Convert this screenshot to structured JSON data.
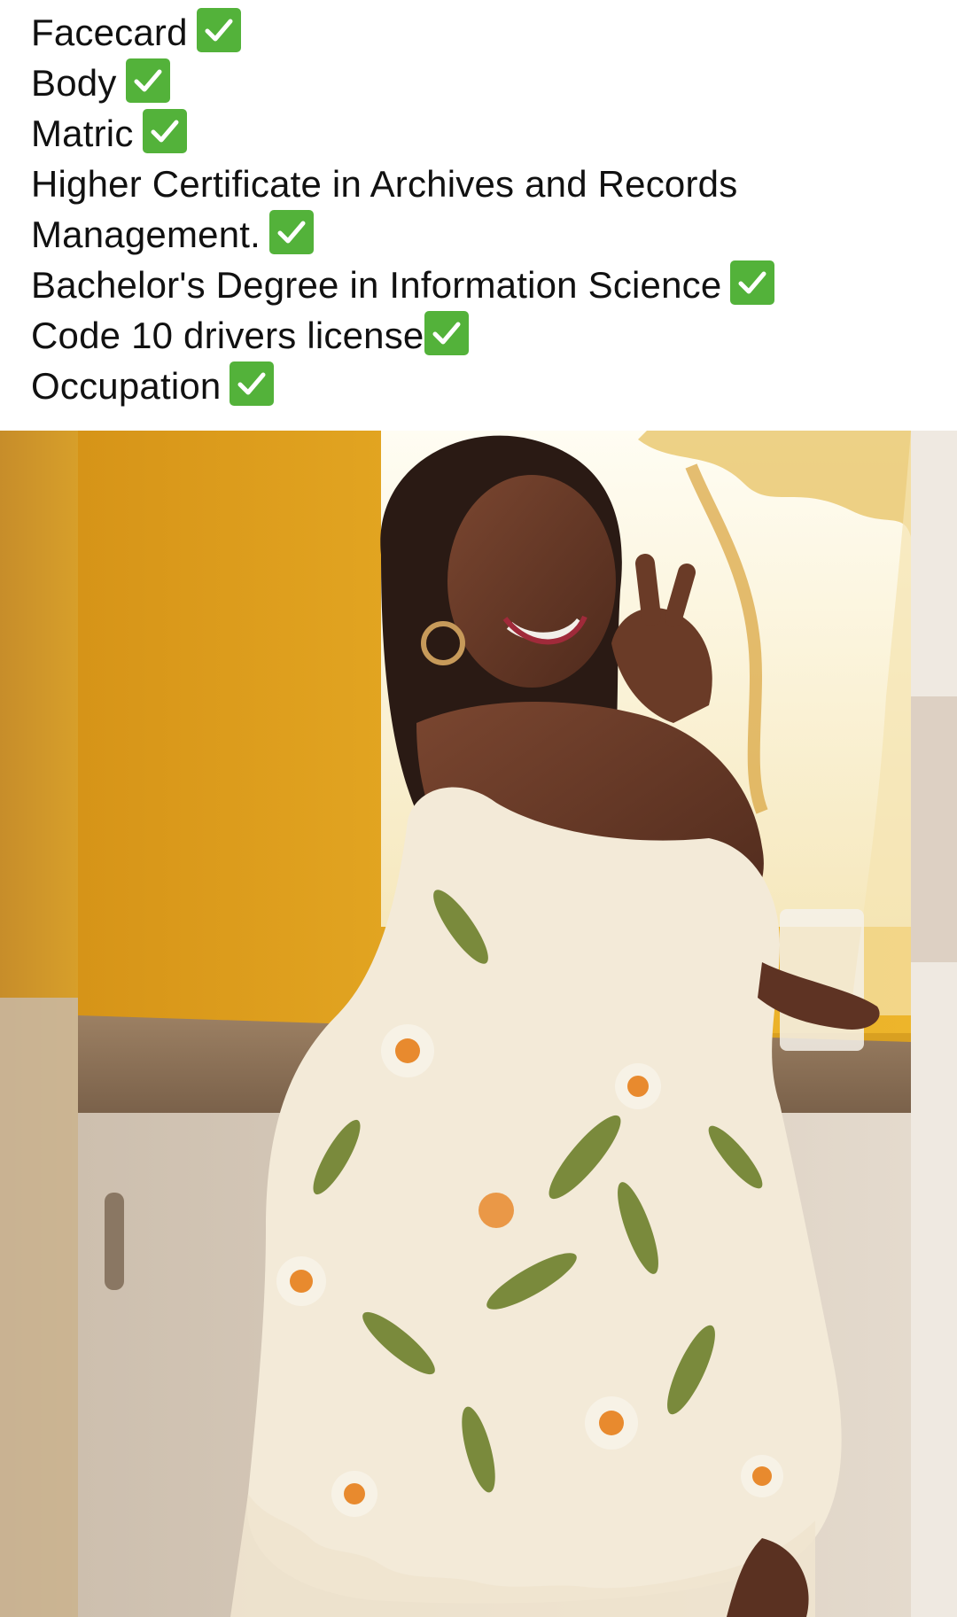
{
  "post": {
    "lines": [
      {
        "text": "Facecard",
        "check": "check-mark-icon"
      },
      {
        "text": "Body",
        "check": "check-mark-icon"
      },
      {
        "text": "Matric",
        "check": "check-mark-icon"
      },
      {
        "text": "Higher Certificate in Archives and Records",
        "check": null
      },
      {
        "text": "Management.",
        "check": "check-mark-icon"
      },
      {
        "text": "Bachelor's Degree in Information Science",
        "check": "check-mark-icon"
      },
      {
        "text": "Code 10 drivers license",
        "check": "check-mark-icon"
      },
      {
        "text": "Occupation",
        "check": "check-mark-icon"
      }
    ]
  },
  "photo": {
    "subject": "woman-in-floral-dress",
    "colors": {
      "wall": "#e0a21f",
      "curtain": "#f6ecc8",
      "dress": "#f3ead8",
      "leaf": "#7a8a3c",
      "flower": "#e88a2e",
      "counter": "#8c6e52",
      "cabinet": "#d8cdbf"
    }
  }
}
